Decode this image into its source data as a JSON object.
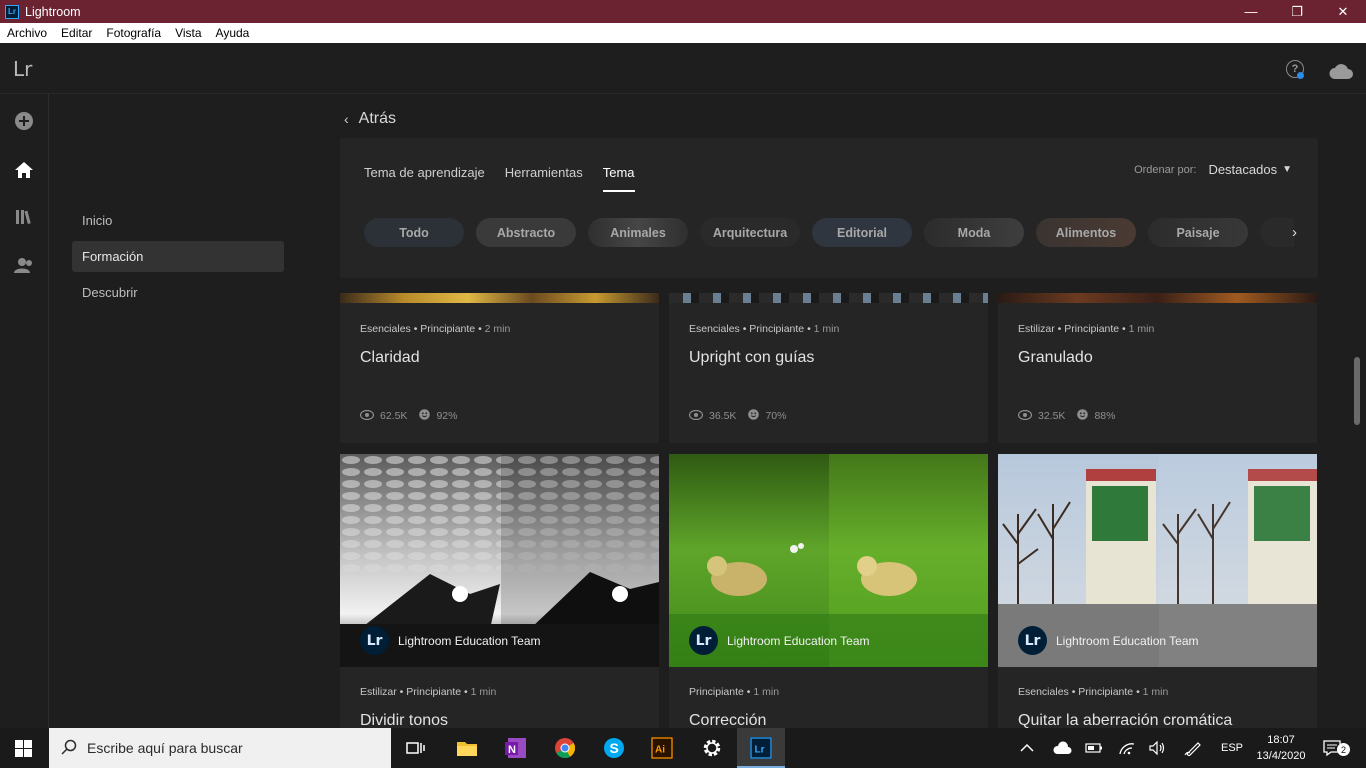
{
  "window": {
    "title": "Lightroom",
    "app_icon": "Lr",
    "minimize": "—",
    "maximize": "❐",
    "close": "✕"
  },
  "menu": [
    "Archivo",
    "Editar",
    "Fotografía",
    "Vista",
    "Ayuda"
  ],
  "header": {
    "logo": "Lr",
    "help_icon": "?"
  },
  "rail": {
    "icons": [
      "add-icon",
      "home-icon",
      "library-icon",
      "people-icon"
    ],
    "active": "home-icon"
  },
  "subnav": {
    "items": [
      "Inicio",
      "Formación",
      "Descubrir"
    ],
    "active": "Formación"
  },
  "main": {
    "back_label": "Atrás",
    "tabs": [
      "Tema de aprendizaje",
      "Herramientas",
      "Tema"
    ],
    "active_tab": "Tema",
    "sort": {
      "label": "Ordenar por:",
      "value": "Destacados"
    },
    "chips": [
      "Todo",
      "Abstracto",
      "Animales",
      "Arquitectura",
      "Editorial",
      "Moda",
      "Alimentos",
      "Paisaje"
    ],
    "cards_top": [
      {
        "tags": "Esenciales • Principiante •",
        "duration": "2 min",
        "title": "Claridad",
        "views": "62.5K",
        "rating": "92%"
      },
      {
        "tags": "Esenciales • Principiante •",
        "duration": "1 min",
        "title": "Upright con guías",
        "views": "36.5K",
        "rating": "70%"
      },
      {
        "tags": "Estilizar • Principiante •",
        "duration": "1 min",
        "title": "Granulado",
        "views": "32.5K",
        "rating": "88%"
      }
    ],
    "cards_bottom": [
      {
        "author": "Lightroom Education Team",
        "avatar": "Lr",
        "tags": "Estilizar • Principiante •",
        "duration": "1 min",
        "title": "Dividir tonos"
      },
      {
        "author": "Lightroom Education Team",
        "avatar": "Lr",
        "tags": "Principiante •",
        "duration": "1 min",
        "title": "Corrección"
      },
      {
        "author": "Lightroom Education Team",
        "avatar": "Lr",
        "tags": "Esenciales • Principiante •",
        "duration": "1 min",
        "title": "Quitar la aberración cromática"
      }
    ]
  },
  "taskbar": {
    "search_placeholder": "Escribe aquí para buscar",
    "lang": "ESP",
    "time": "18:07",
    "date": "13/4/2020",
    "notifications": "2",
    "apps": [
      "task-view-icon",
      "file-explorer-icon",
      "onenote-icon",
      "chrome-icon",
      "skype-icon",
      "illustrator-icon",
      "settings-icon",
      "lightroom-icon"
    ]
  }
}
